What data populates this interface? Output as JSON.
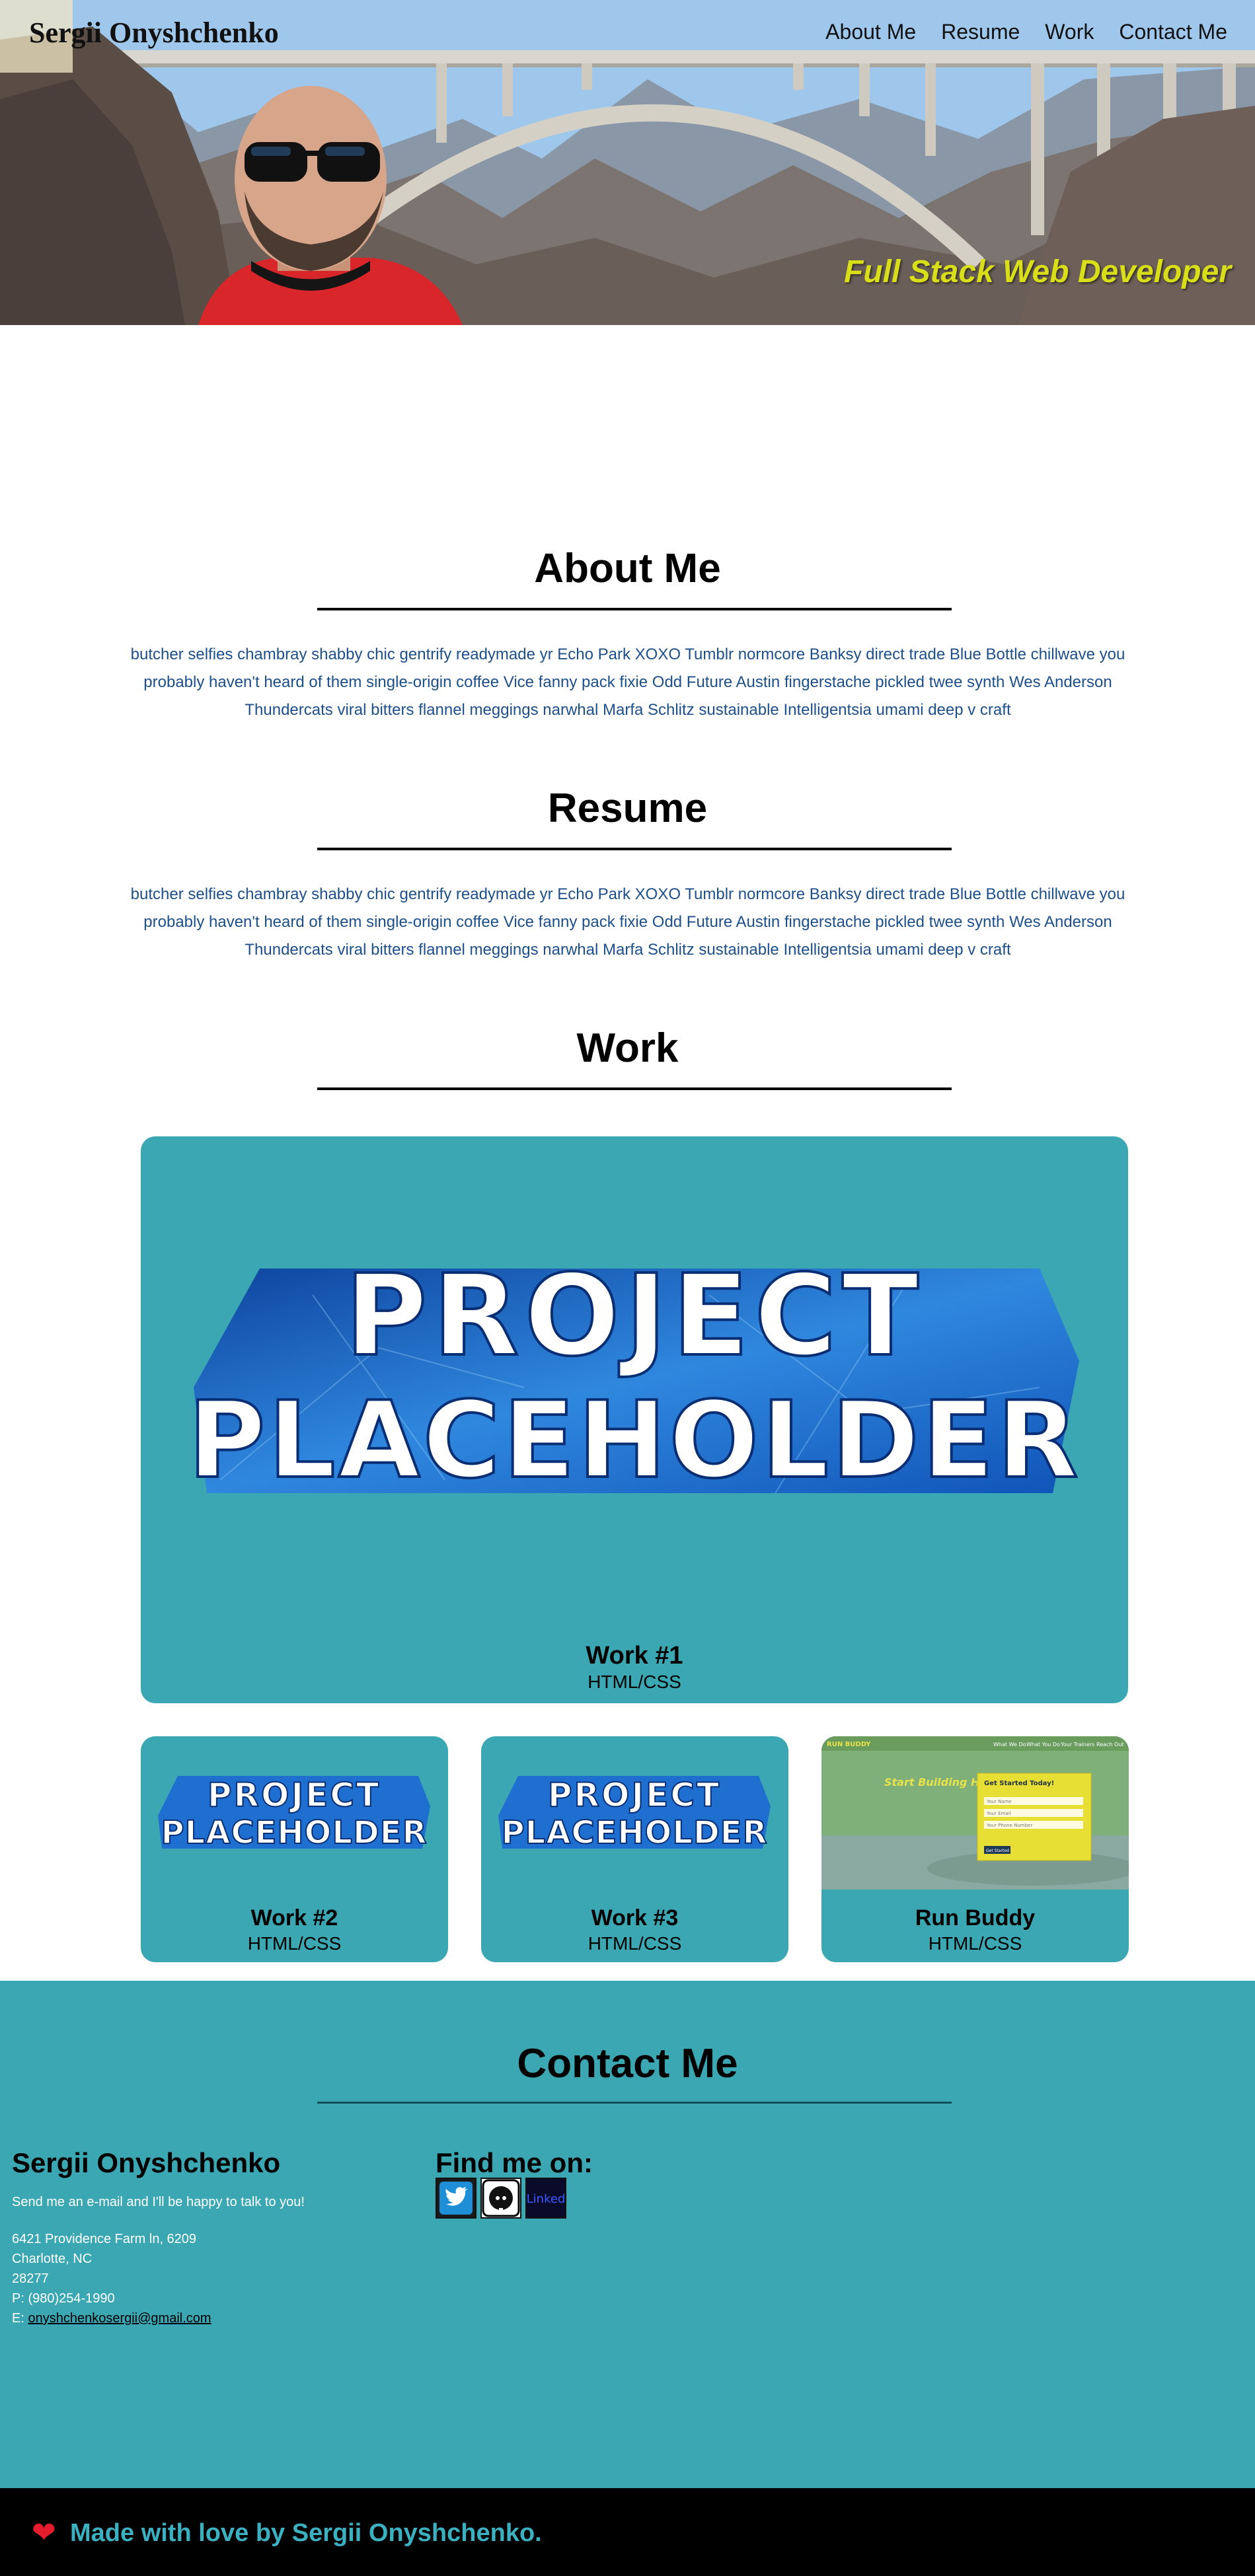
{
  "header": {
    "brand": "Sergii Onyshchenko",
    "tagline": "Full Stack Web Developer",
    "nav": [
      "About Me",
      "Resume",
      "Work",
      "Contact Me"
    ]
  },
  "about": {
    "title": "About Me",
    "text": "butcher selfies chambray shabby chic gentrify readymade yr Echo Park XOXO Tumblr normcore Banksy direct trade Blue Bottle chillwave you probably haven't heard of them single-origin coffee Vice fanny pack fixie Odd Future Austin fingerstache pickled twee synth Wes Anderson Thundercats viral bitters flannel meggings narwhal Marfa Schlitz sustainable Intelligentsia umami deep v craft"
  },
  "resume": {
    "title": "Resume",
    "text": "butcher selfies chambray shabby chic gentrify readymade yr Echo Park XOXO Tumblr normcore Banksy direct trade Blue Bottle chillwave you probably haven't heard of them single-origin coffee Vice fanny pack fixie Odd Future Austin fingerstache pickled twee synth Wes Anderson Thundercats viral bitters flannel meggings narwhal Marfa Schlitz sustainable Intelligentsia umami deep v craft"
  },
  "work": {
    "title": "Work",
    "placeholder_line1": "PROJECT",
    "placeholder_line2": "PLACEHOLDER",
    "projects": [
      {
        "title": "Work #1",
        "tech": "HTML/CSS"
      },
      {
        "title": "Work #2",
        "tech": "HTML/CSS"
      },
      {
        "title": "Work #3",
        "tech": "HTML/CSS"
      },
      {
        "title": "Run Buddy",
        "tech": "HTML/CSS"
      }
    ],
    "run_buddy_shot": {
      "logo": "RUN BUDDY",
      "nav": [
        "What We Do",
        "What You Do",
        "Your Trainers",
        "Reach Out"
      ],
      "headline": "Start Building Habits.",
      "form_title": "Get Started Today!",
      "fields": [
        "Your Name",
        "Your Email",
        "Your Phone Number"
      ],
      "button": "Get Started"
    },
    "colors": {
      "card": "#3aa7b2"
    }
  },
  "contact": {
    "title": "Contact Me",
    "name": "Sergii Onyshchenko",
    "intro": "Send me an e-mail and I'll be happy to talk to you!",
    "address1": "6421 Providence Farm ln, 6209",
    "address2": "Charlotte, NC",
    "zip": "28277",
    "phone": "P: (980)254-1990",
    "email_label": "E: ",
    "email": "onyshchenkosergii@gmail.com",
    "find_me": "Find me on:",
    "socials": [
      "twitter-icon",
      "github-icon",
      "linkedin-icon"
    ],
    "socials_text": {
      "linkedin": "Linked"
    }
  },
  "footer": {
    "text": "Made with love by Sergii Onyshchenko.",
    "icon": "heart-icon"
  }
}
